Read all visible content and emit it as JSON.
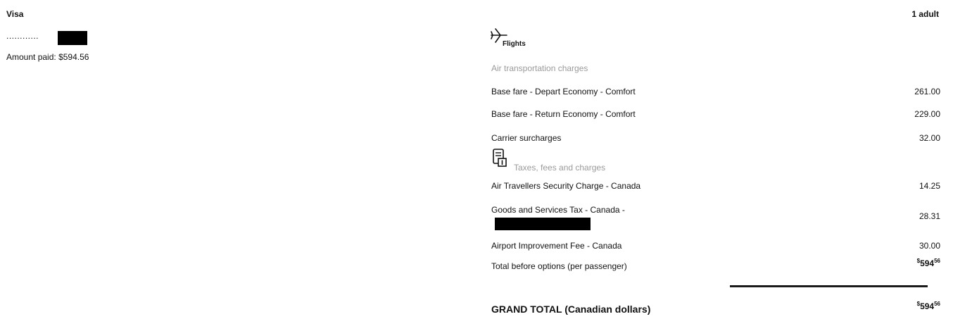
{
  "payment": {
    "method": "Visa",
    "card_mask": "............",
    "amount_paid_label": "Amount paid",
    "amount_paid_value": "$594.56"
  },
  "passengers": "1 adult",
  "flights_label": "Flights",
  "air_section_label": "Air transportation charges",
  "air_items": [
    {
      "label": "Base fare - Depart Economy - Comfort",
      "amount": "261.00"
    },
    {
      "label": "Base fare - Return Economy - Comfort",
      "amount": "229.00"
    },
    {
      "label": "Carrier surcharges",
      "amount": "32.00"
    }
  ],
  "tax_section_label": "Taxes, fees and charges",
  "tax_items": [
    {
      "label": "Air Travellers Security Charge - Canada",
      "amount": "14.25"
    },
    {
      "label": "Goods and Services Tax - Canada -",
      "amount": "28.31"
    },
    {
      "label": "Airport Improvement Fee - Canada",
      "amount": "30.00"
    }
  ],
  "total_before": {
    "label": "Total before options (per passenger)",
    "currency": "$",
    "whole": "594",
    "cents": "56"
  },
  "grand_total": {
    "label": "GRAND TOTAL (Canadian dollars)",
    "currency": "$",
    "whole": "594",
    "cents": "56"
  }
}
